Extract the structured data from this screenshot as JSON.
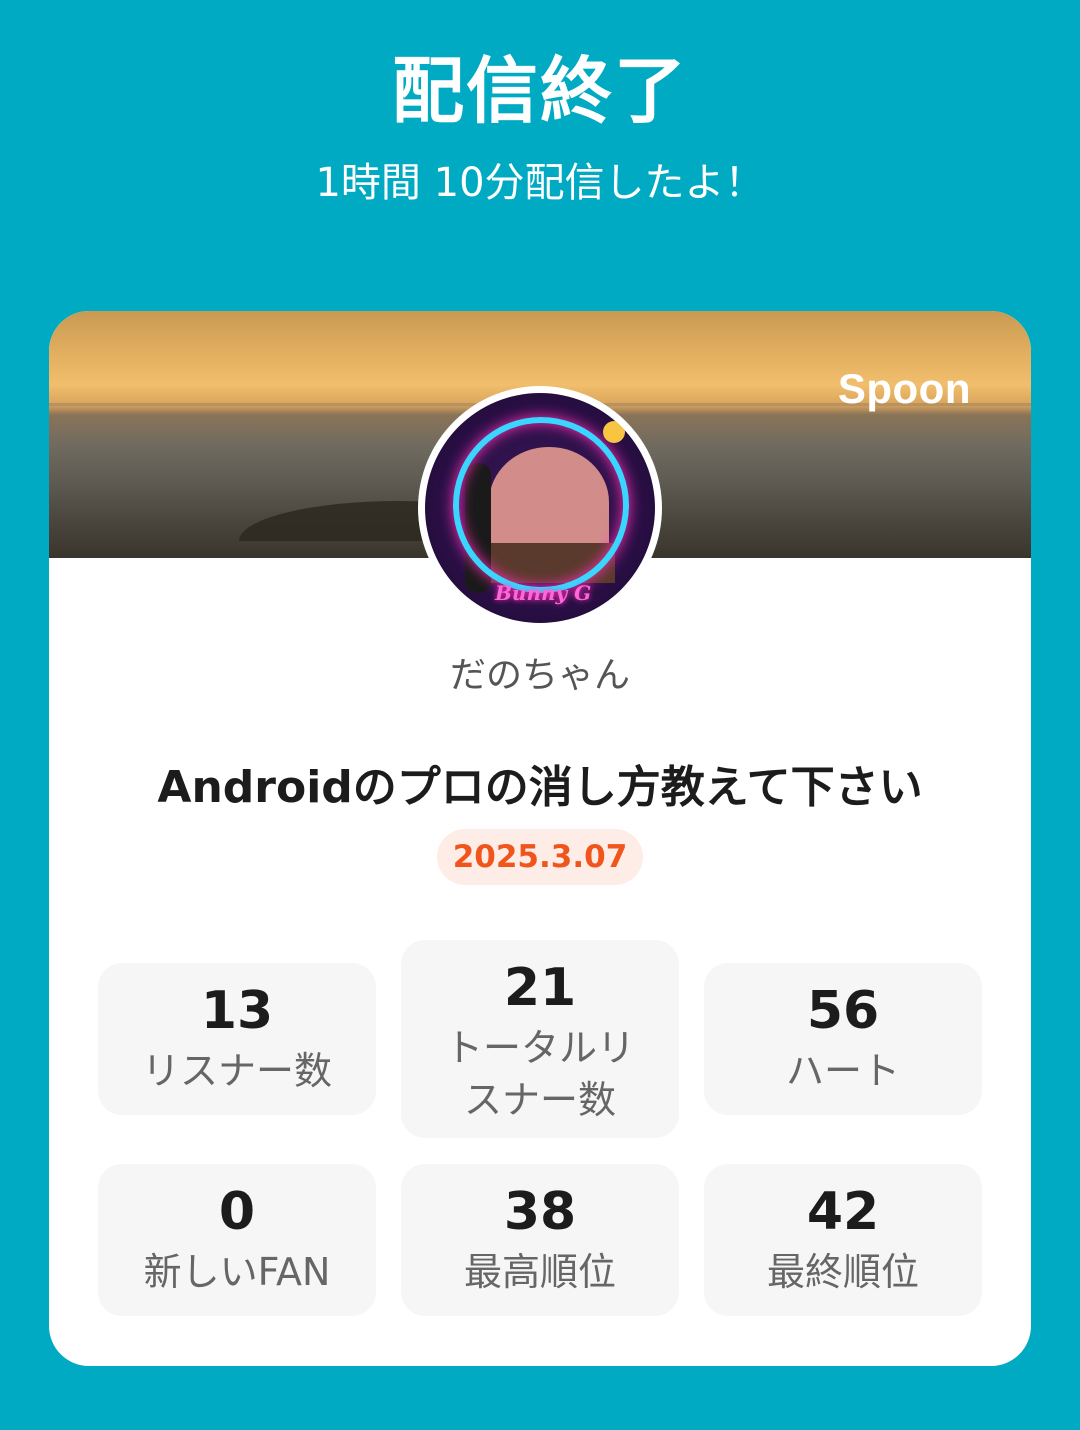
{
  "header": {
    "title": "配信終了",
    "subtitle": "1時間 10分配信したよ！"
  },
  "card": {
    "brand": "Spoon",
    "avatar_overlay_text": "Bunny G",
    "username": "だのちゃん",
    "stream_title": "Androidのプロの消し方教えて下さい",
    "date": "2025.3.07"
  },
  "stats": [
    {
      "value": "13",
      "label": "リスナー数"
    },
    {
      "value": "21",
      "label": "トータルリスナー数"
    },
    {
      "value": "56",
      "label": "ハート"
    },
    {
      "value": "0",
      "label": "新しいFAN"
    },
    {
      "value": "38",
      "label": "最高順位"
    },
    {
      "value": "42",
      "label": "最終順位"
    }
  ],
  "colors": {
    "background": "#00aac3",
    "date_text": "#f0551c",
    "date_badge": "#feede6"
  }
}
